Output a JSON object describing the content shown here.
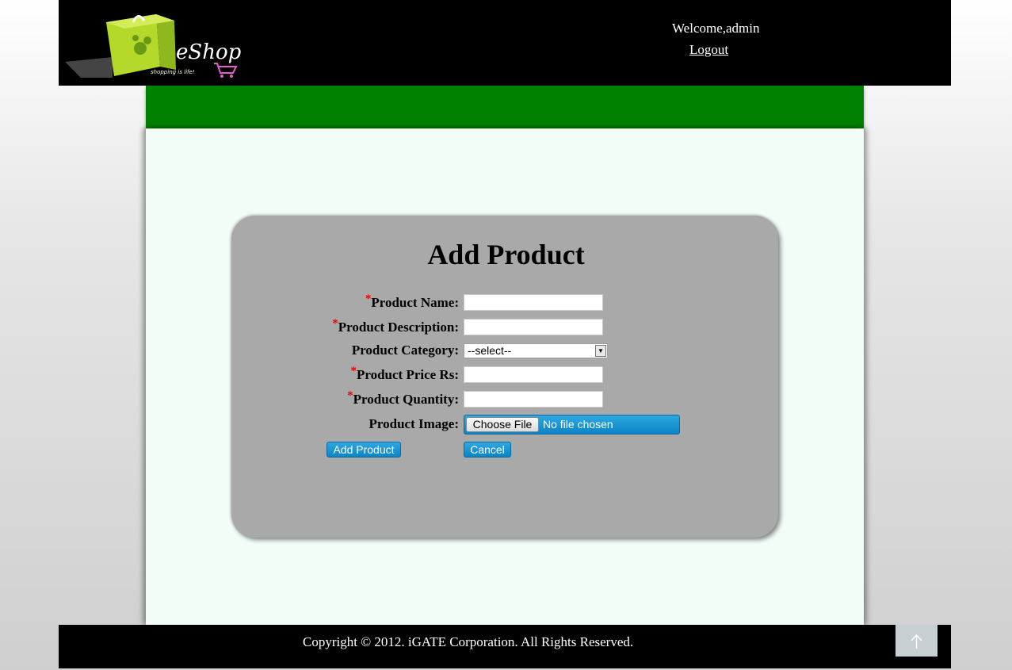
{
  "header": {
    "logo_text": "eShop",
    "logo_tagline": "shopping is life!",
    "welcome": "Welcome,admin",
    "logout": "Logout"
  },
  "form": {
    "title": "Add Product",
    "required_marker": "*",
    "fields": {
      "product_name": {
        "label": "Product Name:",
        "value": ""
      },
      "product_description": {
        "label": "Product Description:",
        "value": ""
      },
      "product_category": {
        "label": "Product Category:",
        "selected": "--select--"
      },
      "product_price": {
        "label": "Product Price Rs:",
        "value": ""
      },
      "product_quantity": {
        "label": "Product Quantity:",
        "value": ""
      },
      "product_image": {
        "label": "Product Image:",
        "button": "Choose File",
        "status": "No file chosen"
      }
    },
    "add_button": "Add Product",
    "cancel_button": "Cancel"
  },
  "footer": {
    "copyright": "Copyright © 2012. iGATE Corporation. All Rights Reserved."
  },
  "colors": {
    "header_bg": "#000000",
    "nav_bar": "#008000",
    "content_bg": "#f2fdf8",
    "panel_bg": "#a9a9a9",
    "button_blue": "#0b84c6",
    "required": "#e00000"
  }
}
